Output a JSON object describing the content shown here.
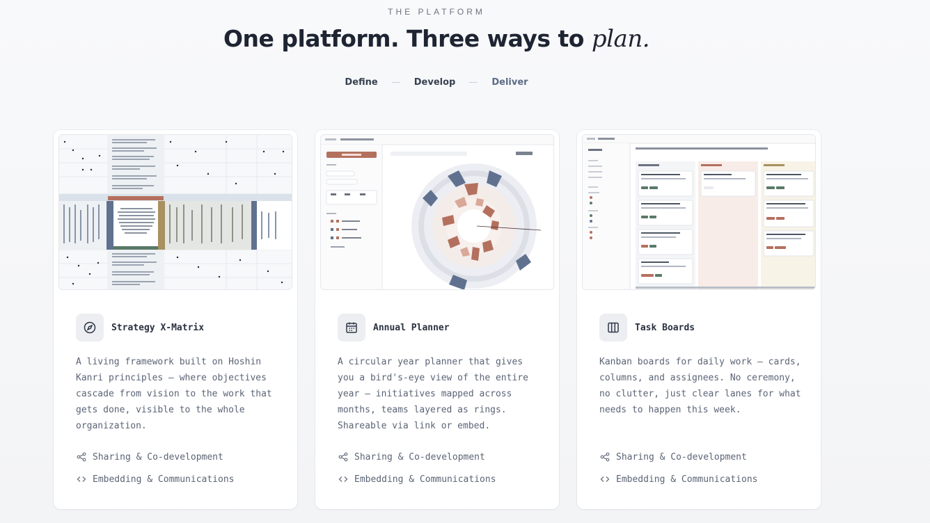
{
  "section": {
    "eyebrow": "THE PLATFORM",
    "headline_main": "One platform. Three ways to",
    "headline_italic": "plan."
  },
  "steps": [
    "Define",
    "Develop",
    "Deliver"
  ],
  "cards": [
    {
      "title": "Strategy X-Matrix",
      "icon": "compass-icon",
      "description": "A living framework built on Hoshin Kanri principles — where objectives cascade from vision to the work that gets done, visible to the whole organization.",
      "features": [
        "Sharing & Co-development",
        "Embedding & Communications"
      ]
    },
    {
      "title": "Annual Planner",
      "icon": "calendar-icon",
      "description": "A circular year planner that gives you a bird's-eye view of the entire year — initiatives mapped across months, teams layered as rings. Shareable via link or embed.",
      "features": [
        "Sharing & Co-development",
        "Embedding & Communications"
      ]
    },
    {
      "title": "Task Boards",
      "icon": "columns-icon",
      "description": "Kanban boards for daily work — cards, columns, and assignees. No ceremony, no clutter, just clear lanes for what needs to happen this week.",
      "features": [
        "Sharing & Co-development",
        "Embedding & Communications"
      ]
    }
  ],
  "colors": {
    "accent": "#5b6b86",
    "muted_red": "#b4705e",
    "slate_blue": "#607190",
    "olive": "#a89060",
    "green": "#5a7a68"
  }
}
